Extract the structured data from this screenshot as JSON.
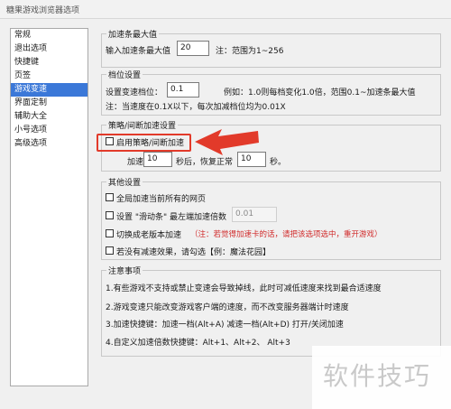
{
  "window": {
    "title": "糖果游戏浏览器选项"
  },
  "sidebar": {
    "items": [
      {
        "label": "常规",
        "active": false
      },
      {
        "label": "退出选项",
        "active": false
      },
      {
        "label": "快捷键",
        "active": false
      },
      {
        "label": "页签",
        "active": false
      },
      {
        "label": "游戏变速",
        "active": true
      },
      {
        "label": "界面定制",
        "active": false
      },
      {
        "label": "辅助大全",
        "active": false
      },
      {
        "label": "小号选项",
        "active": false
      },
      {
        "label": "高级选项",
        "active": false
      }
    ]
  },
  "max_speed": {
    "title": "加速条最大值",
    "label": "输入加速条最大值",
    "value": "20",
    "note": "注：范围为1~256"
  },
  "gear": {
    "title": "档位设置",
    "label": "设置变速档位：",
    "value": "0.1",
    "example": "例如：1.0则每档变化1.0倍，范围0.1~加速条最大值",
    "note": "注：当速度在0.1X以下，每次加减档位均为0.01X"
  },
  "strategy": {
    "title": "策略/间断加速设置",
    "enable_label": "启用策略/间断加速",
    "accel_label": "加速",
    "accel_value": "10",
    "restore_label": "秒后，恢复正常",
    "restore_value": "10",
    "seconds_label": "秒。"
  },
  "other": {
    "title": "其他设置",
    "opt_all_pages": "全局加速当前所有的网页",
    "opt_slider_left": "设置 \"滑动条\" 最左端加速倍数",
    "slider_value": "0.01",
    "opt_old_engine": "切换成老版本加速",
    "old_engine_note": "（注：若觉得加速卡的话，请把该选项选中，重开游戏）",
    "opt_no_effect": "若没有减速效果，请勾选【例：魔法花园】"
  },
  "notes": {
    "title": "注意事项",
    "lines": [
      "1.有些游戏不支持或禁止变速会导致掉线，此时可减低速度来找到最合适速度",
      "2.游戏变速只能改变游戏客户端的速度，而不改变服务器端计时速度",
      "3.加速快捷键：加速一档(Alt+A) 减速一档(Alt+D) 打开/关闭加速",
      "4.自定义加速倍数快捷键：Alt+1、Alt+2、 Alt+3"
    ]
  },
  "watermark": {
    "text": "软件技巧"
  },
  "colors": {
    "selection": "#3b78d8",
    "annotation": "#e23a2a",
    "warning_text": "#d12a2a"
  }
}
